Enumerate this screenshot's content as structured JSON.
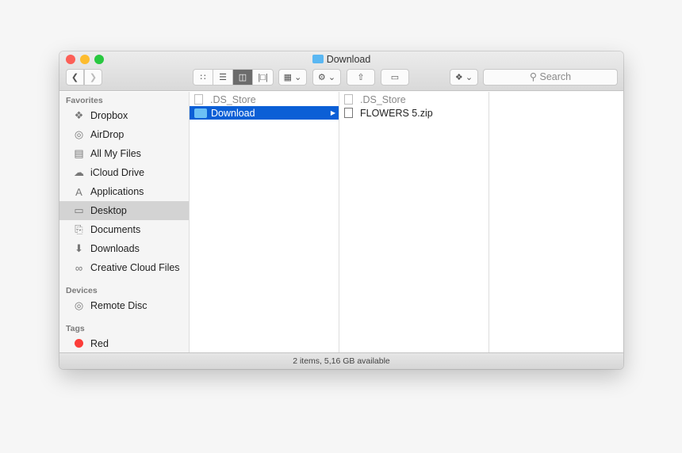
{
  "window": {
    "title": "Download"
  },
  "toolbar": {
    "back_icon": "chevron-left",
    "forward_icon": "chevron-right",
    "views": [
      "icon-view",
      "list-view",
      "column-view",
      "cover-flow-view"
    ],
    "active_view": "column-view",
    "search_placeholder": "Search"
  },
  "sidebar": {
    "favorites_label": "Favorites",
    "favorites": [
      {
        "label": "Dropbox",
        "icon": "dropbox-icon"
      },
      {
        "label": "AirDrop",
        "icon": "airdrop-icon"
      },
      {
        "label": "All My Files",
        "icon": "all-files-icon"
      },
      {
        "label": "iCloud Drive",
        "icon": "cloud-icon"
      },
      {
        "label": "Applications",
        "icon": "applications-icon"
      },
      {
        "label": "Desktop",
        "icon": "desktop-icon",
        "selected": true
      },
      {
        "label": "Documents",
        "icon": "documents-icon"
      },
      {
        "label": "Downloads",
        "icon": "downloads-icon"
      },
      {
        "label": "Creative Cloud Files",
        "icon": "creative-cloud-icon"
      }
    ],
    "devices_label": "Devices",
    "devices": [
      {
        "label": "Remote Disc",
        "icon": "disc-icon"
      }
    ],
    "tags_label": "Tags",
    "tags": [
      {
        "label": "Red",
        "color": "#fc3d39"
      }
    ]
  },
  "columns": [
    {
      "items": [
        {
          "name": ".DS_Store",
          "dim": true
        },
        {
          "name": "Download",
          "selected": true,
          "folder": true
        }
      ]
    },
    {
      "items": [
        {
          "name": ".DS_Store",
          "dim": true
        },
        {
          "name": "FLOWERS 5.zip"
        }
      ]
    }
  ],
  "status": "2 items, 5,16 GB available",
  "colors": {
    "selection": "#0b5fd6",
    "folder": "#5ab7f2"
  }
}
